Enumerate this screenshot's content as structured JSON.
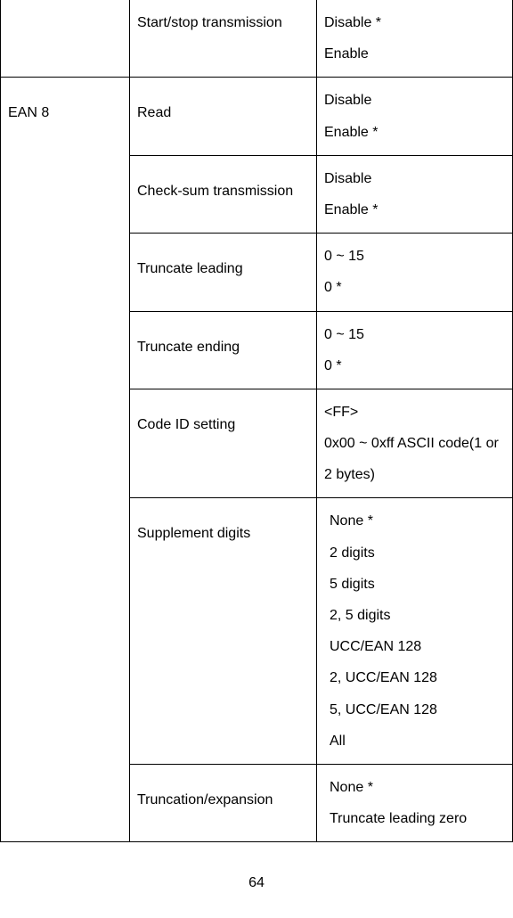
{
  "row1": {
    "c1": "",
    "c2": "Start/stop transmission",
    "c3a": "Disable *",
    "c3b": "Enable"
  },
  "group_label": "EAN 8",
  "rows": {
    "read": {
      "c2": "Read",
      "c3a": "Disable",
      "c3b": "Enable *"
    },
    "checksum": {
      "c2": "Check-sum transmission",
      "c3a": "Disable",
      "c3b": "Enable *"
    },
    "trunc_lead": {
      "c2": "Truncate leading",
      "c3a": "0 ~ 15",
      "c3b": "0 *"
    },
    "trunc_end": {
      "c2": "Truncate ending",
      "c3a": "0 ~ 15",
      "c3b": "0 *"
    },
    "codeid": {
      "c2": "Code ID setting",
      "c3a": "<FF>",
      "c3b": "0x00 ~ 0xff ASCII code(1 or 2 bytes)"
    },
    "supp": {
      "c2": "Supplement digits",
      "c3_0": "None *",
      "c3_1": "2 digits",
      "c3_2": "5 digits",
      "c3_3": "2, 5 digits",
      "c3_4": "UCC/EAN 128",
      "c3_5": "2, UCC/EAN 128",
      "c3_6": "5, UCC/EAN 128",
      "c3_7": "All"
    },
    "trunc_exp": {
      "c2": "Truncation/expansion",
      "c3a": "None *",
      "c3b": "Truncate leading zero"
    }
  },
  "page_number": "64"
}
